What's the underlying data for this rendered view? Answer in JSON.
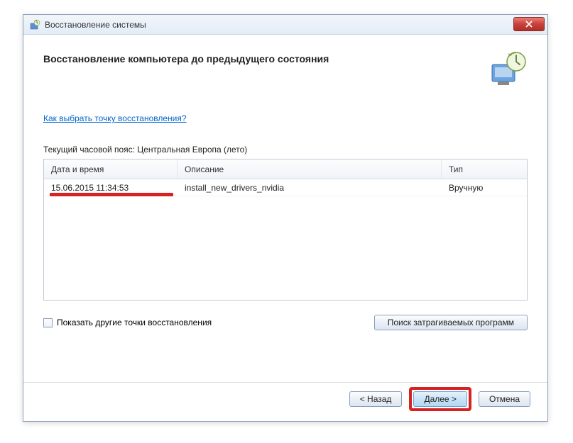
{
  "titlebar": {
    "title": "Восстановление системы"
  },
  "header": {
    "title": "Восстановление компьютера до предыдущего состояния"
  },
  "help_link": "Как выбрать точку восстановления?",
  "timezone_label": "Текущий часовой пояс: Центральная Европа (лето)",
  "table": {
    "headers": {
      "date": "Дата и время",
      "desc": "Описание",
      "type": "Тип"
    },
    "rows": [
      {
        "date": "15.06.2015 11:34:53",
        "desc": "install_new_drivers_nvidia",
        "type": "Вручную"
      }
    ]
  },
  "checkbox_label": "Показать другие точки восстановления",
  "buttons": {
    "scan": "Поиск затрагиваемых программ",
    "back": "< Назад",
    "next": "Далее >",
    "cancel": "Отмена"
  }
}
